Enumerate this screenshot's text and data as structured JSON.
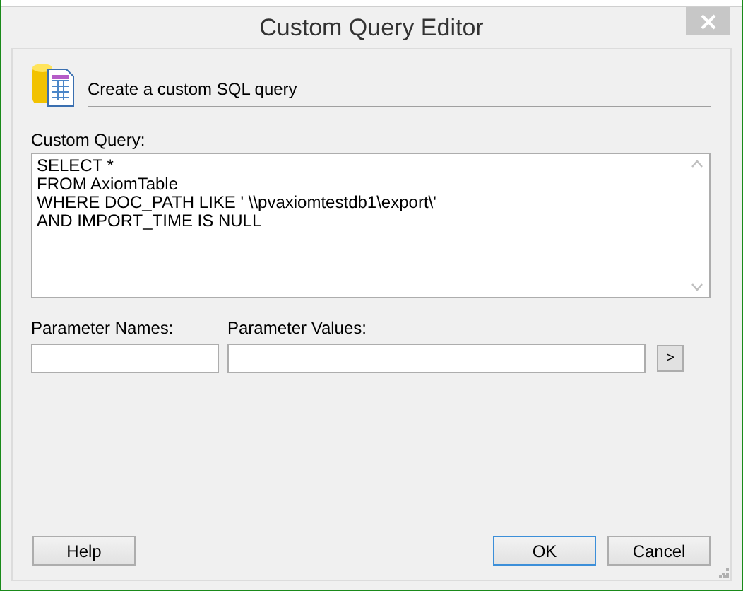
{
  "window": {
    "title": "Custom Query Editor"
  },
  "header": {
    "text": "Create a custom SQL query"
  },
  "query": {
    "label": "Custom Query:",
    "value": "SELECT *\nFROM AxiomTable\nWHERE DOC_PATH LIKE ' \\\\pvaxiomtestdb1\\export\\'\nAND IMPORT_TIME IS NULL"
  },
  "parameters": {
    "names_label": "Parameter Names:",
    "values_label": "Parameter Values:",
    "expand_button": ">"
  },
  "left_buttons": [
    {
      "label": "Help",
      "default": false
    }
  ],
  "right_buttons": [
    {
      "label": "OK",
      "default": true
    },
    {
      "label": "Cancel",
      "default": false
    }
  ]
}
